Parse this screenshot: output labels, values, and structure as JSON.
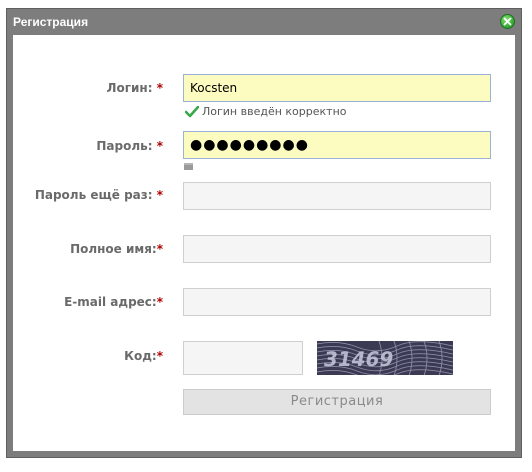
{
  "dialog": {
    "title": "Регистрация"
  },
  "form": {
    "login": {
      "label": "Логин:",
      "required": "*",
      "value": "Kocsten",
      "hint": "Логин введён корректно"
    },
    "password": {
      "label": "Пароль:",
      "required": "*",
      "value": "●●●●●●●●●"
    },
    "password_repeat": {
      "label": "Пароль ещё раз:",
      "required": "*",
      "value": ""
    },
    "full_name": {
      "label": "Полное имя:",
      "required": "*",
      "value": ""
    },
    "email": {
      "label": "E-mail адрес:",
      "required": "*",
      "value": ""
    },
    "captcha": {
      "label": "Код:",
      "required": "*",
      "value": "",
      "image_text": "31469"
    },
    "submit_label": "Регистрация"
  },
  "colors": {
    "title_bar": "#7d7d7d",
    "active_field": "#fcfcc0",
    "required_mark": "#b10000",
    "ok_check": "#3aa84a"
  }
}
